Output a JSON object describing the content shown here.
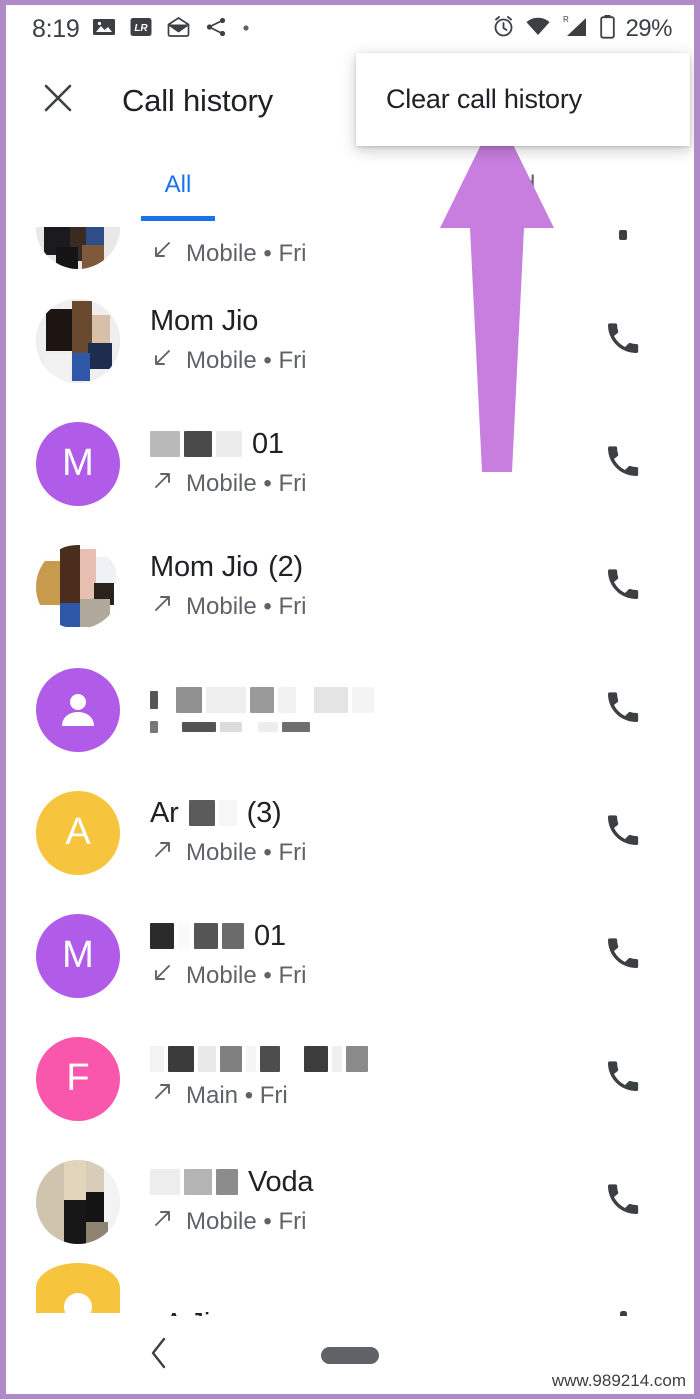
{
  "status_bar": {
    "time": "8:19",
    "left_icons": [
      "photo-icon",
      "lightroom-icon",
      "mail-icon",
      "share-icon",
      "dot-icon"
    ],
    "lightroom_label": "LR",
    "right_icons": [
      "alarm-icon",
      "wifi-icon",
      "signal-roaming-icon",
      "battery-icon"
    ],
    "roaming_label": "R",
    "battery_percent": "29%"
  },
  "app_bar": {
    "close_icon": "close-icon",
    "title": "Call history"
  },
  "menu": {
    "items": [
      {
        "label": "Clear call history"
      }
    ]
  },
  "tabs": [
    {
      "label": "All",
      "active": true
    },
    {
      "label": "Missed",
      "active": false,
      "truncated_label": "ed"
    }
  ],
  "colors": {
    "accent_blue": "#1a73e8",
    "frame_purple": "#b18ac9",
    "arrow_purple": "#c77ede",
    "avatar_purple": "#b05ce8",
    "avatar_amber": "#f7c53d",
    "avatar_pink": "#f957ab",
    "text_primary": "#202124",
    "text_secondary": "#5f6368"
  },
  "call_list": [
    {
      "name": "",
      "avatar_type": "photo",
      "avatar_letter": "",
      "avatar_color": "",
      "direction": "incoming",
      "line_type": "Mobile",
      "day": "Fri",
      "subtitle": "Mobile • Fri",
      "count": "",
      "redacted": true,
      "partial": true
    },
    {
      "name": "Mom Jio",
      "avatar_type": "photo",
      "avatar_letter": "",
      "avatar_color": "",
      "direction": "incoming",
      "line_type": "Mobile",
      "day": "Fri",
      "subtitle": "Mobile • Fri",
      "count": "",
      "redacted": false,
      "partial": false
    },
    {
      "name": "01",
      "avatar_type": "letter",
      "avatar_letter": "M",
      "avatar_color": "#b05ce8",
      "direction": "outgoing",
      "line_type": "Mobile",
      "day": "Fri",
      "subtitle": "Mobile • Fri",
      "count": "",
      "redacted": true,
      "partial": false
    },
    {
      "name": "Mom Jio",
      "avatar_type": "photo",
      "avatar_letter": "",
      "avatar_color": "",
      "direction": "outgoing",
      "line_type": "Mobile",
      "day": "Fri",
      "subtitle": "Mobile • Fri",
      "count": "(2)",
      "redacted": false,
      "partial": false
    },
    {
      "name": "",
      "avatar_type": "person",
      "avatar_letter": "",
      "avatar_color": "#b05ce8",
      "direction": "outgoing",
      "line_type": "",
      "day": "",
      "subtitle": "",
      "count": "",
      "redacted": true,
      "partial": false
    },
    {
      "name": "Ar",
      "avatar_type": "letter",
      "avatar_letter": "A",
      "avatar_color": "#f7c53d",
      "direction": "outgoing",
      "line_type": "Mobile",
      "day": "Fri",
      "subtitle": "Mobile • Fri",
      "count": "(3)",
      "redacted": true,
      "partial": false
    },
    {
      "name": "01",
      "avatar_type": "letter",
      "avatar_letter": "M",
      "avatar_color": "#b05ce8",
      "direction": "incoming",
      "line_type": "Mobile",
      "day": "Fri",
      "subtitle": "Mobile • Fri",
      "count": "",
      "redacted": true,
      "partial": false
    },
    {
      "name": "",
      "avatar_type": "letter",
      "avatar_letter": "F",
      "avatar_color": "#f957ab",
      "direction": "outgoing",
      "line_type": "Main",
      "day": "Fri",
      "subtitle": "Main • Fri",
      "count": "",
      "redacted": true,
      "partial": false
    },
    {
      "name": "Voda",
      "avatar_type": "photo",
      "avatar_letter": "",
      "avatar_color": "",
      "direction": "outgoing",
      "line_type": "Mobile",
      "day": "Fri",
      "subtitle": "Mobile • Fri",
      "count": "",
      "redacted": true,
      "partial": false
    },
    {
      "name": ". A Jio",
      "avatar_type": "half-dome",
      "avatar_letter": "",
      "avatar_color": "#f7c53d",
      "direction": "",
      "line_type": "",
      "day": "",
      "subtitle": "",
      "count": "",
      "redacted": false,
      "partial": false
    }
  ],
  "nav_bar": {
    "back_icon": "back-chevron-icon",
    "home_pill": "home-pill-handle"
  },
  "watermark": "www.989214.com"
}
